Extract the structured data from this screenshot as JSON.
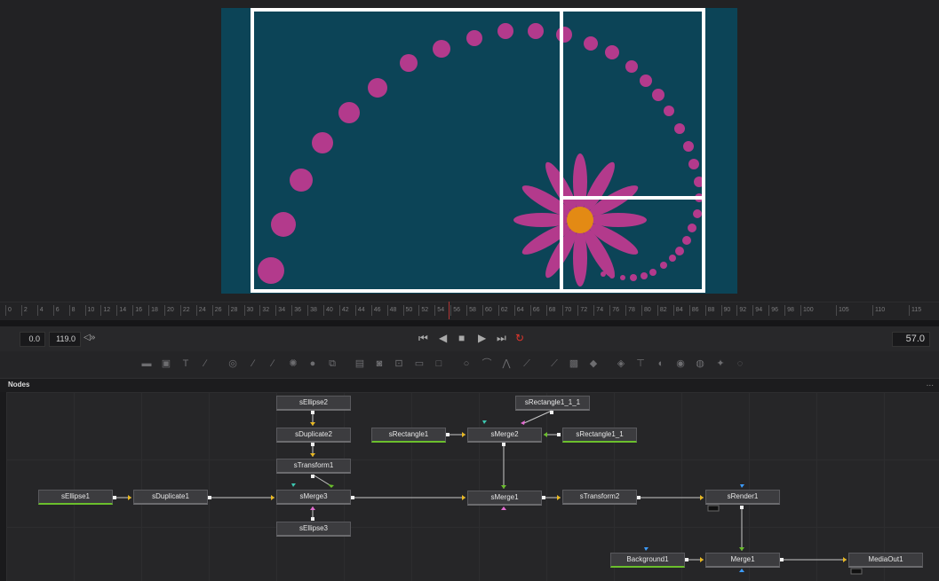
{
  "timeline": {
    "ticks": [
      "0",
      "2",
      "4",
      "6",
      "8",
      "10",
      "12",
      "14",
      "16",
      "18",
      "20",
      "22",
      "24",
      "26",
      "28",
      "30",
      "32",
      "34",
      "36",
      "38",
      "40",
      "42",
      "44",
      "46",
      "48",
      "50",
      "52",
      "54",
      "56",
      "58",
      "60",
      "62",
      "64",
      "66",
      "68",
      "70",
      "72",
      "74",
      "76",
      "78",
      "80",
      "82",
      "84",
      "86",
      "88",
      "90",
      "92",
      "94",
      "96",
      "98",
      "100",
      "105",
      "110",
      "115"
    ]
  },
  "transport": {
    "start_time": "0.0",
    "end_time": "119.0",
    "audio_icon": "speaker-icon",
    "current_frame": "57.0",
    "buttons": [
      "skip-to-start-icon",
      "play-reverse-icon",
      "stop-icon",
      "play-icon",
      "skip-to-end-icon",
      "loop-icon"
    ],
    "loop_color": "#e0362c"
  },
  "toolbar": {
    "tools": [
      "background-tool-icon",
      "paint-tool-icon",
      "text-tool-icon",
      "brush-tool-icon",
      "blur-tool-icon",
      "color-corrector-icon",
      "curves-icon",
      "glow-icon",
      "bright-contrast-icon",
      "merge-icon",
      "channel-booleans-icon",
      "matte-control-icon",
      "transform-icon",
      "resize-icon",
      "crop-icon",
      "rectangle-mask-icon",
      "ellipse-mask-icon",
      "polygon-mask-icon",
      "bspline-mask-icon",
      "particle-emitter-icon",
      "particle-render-icon",
      "tracker-icon",
      "shape-3d-icon",
      "merge-3d-icon",
      "camera-3d-icon",
      "text-3d-icon",
      "renderer-3d-icon",
      "light-icon",
      "image-plane-icon"
    ]
  },
  "nodes_panel": {
    "title": "Nodes",
    "menu": "..."
  },
  "nodes": {
    "sEllipse2": "sEllipse2",
    "sDuplicate2": "sDuplicate2",
    "sTransform1": "sTransform1",
    "sEllipse1": "sEllipse1",
    "sDuplicate1": "sDuplicate1",
    "sMerge3": "sMerge3",
    "sEllipse3": "sEllipse3",
    "sRectangle1_1_1": "sRectangle1_1_1",
    "sRectangle1": "sRectangle1",
    "sMerge2": "sMerge2",
    "sRectangle1_1": "sRectangle1_1",
    "sMerge1": "sMerge1",
    "sTransform2": "sTransform2",
    "sRender1": "sRender1",
    "Background1": "Background1",
    "Merge1": "Merge1",
    "MediaOut1": "MediaOut1"
  },
  "colors": {
    "canvas_bg": "#0c4457",
    "dot": "#b33a8c",
    "petal": "#b33a8c",
    "flower_center": "#e38a14",
    "guide_lines": "#ffffff"
  }
}
